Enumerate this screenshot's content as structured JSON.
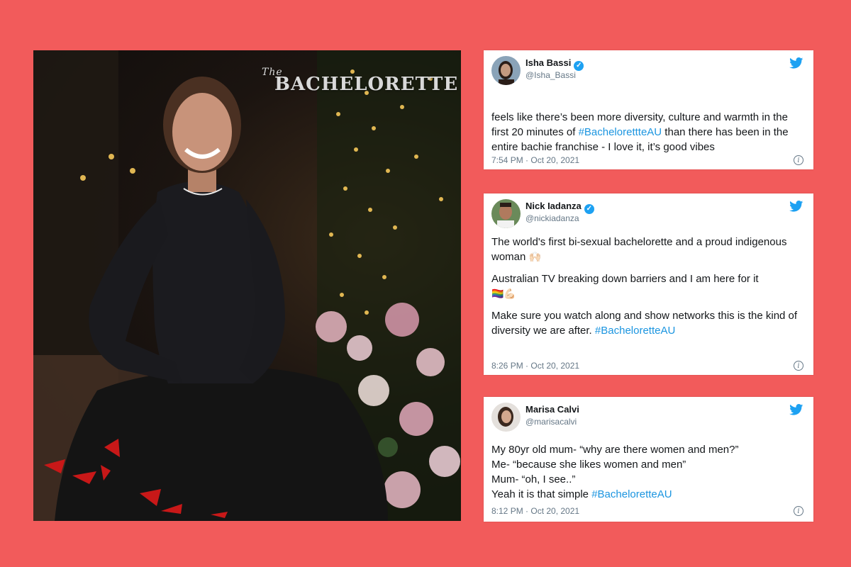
{
  "photo": {
    "logo_prefix": "The",
    "logo_text": "BACHELORETTE"
  },
  "tweets": [
    {
      "name": "Isha Bassi",
      "handle": "@Isha_Bassi",
      "text": "feels like there’s been more diversity, culture and warmth in the first 20 minutes of ",
      "hashtag": "#BachelorettteAU",
      "text_after": " than there has been in the entire bachie franchise - I love it, it’s good vibes",
      "time": "7:54 PM · Oct 20, 2021",
      "verified": true
    },
    {
      "name": "Nick Iadanza",
      "handle": "@nickiadanza",
      "para1": "The world's first bi-sexual bachelorette and a proud indigenous woman",
      "para1_emoji": "🙌🏻",
      "para2": "Australian TV breaking down barriers and I am here for it",
      "para2_emoji": "🏳️‍🌈💪🏻",
      "para3": "Make sure you watch along and show networks this is the kind of diversity we are after. ",
      "hashtag": "#BacheloretteAU",
      "time": "8:26 PM · Oct 20, 2021",
      "verified": true
    },
    {
      "name": "Marisa Calvi",
      "handle": "@marisacalvi",
      "line1": "My 80yr old mum- “why are there women and men?”",
      "line2": "Me- “because she likes women and men”",
      "line3": "Mum- “oh, I see..”",
      "line4": "Yeah it is that simple ",
      "hashtag": "#BacheloretteAU",
      "time": "8:12 PM · Oct 20, 2021",
      "verified": false
    }
  ],
  "icons": {
    "verified": "verified-badge-icon",
    "twitter": "twitter-bird-icon",
    "info": "info-icon"
  },
  "colors": {
    "background": "#f25b5b",
    "twitter_blue": "#1da1f2",
    "hashtag": "#1b95e0"
  }
}
